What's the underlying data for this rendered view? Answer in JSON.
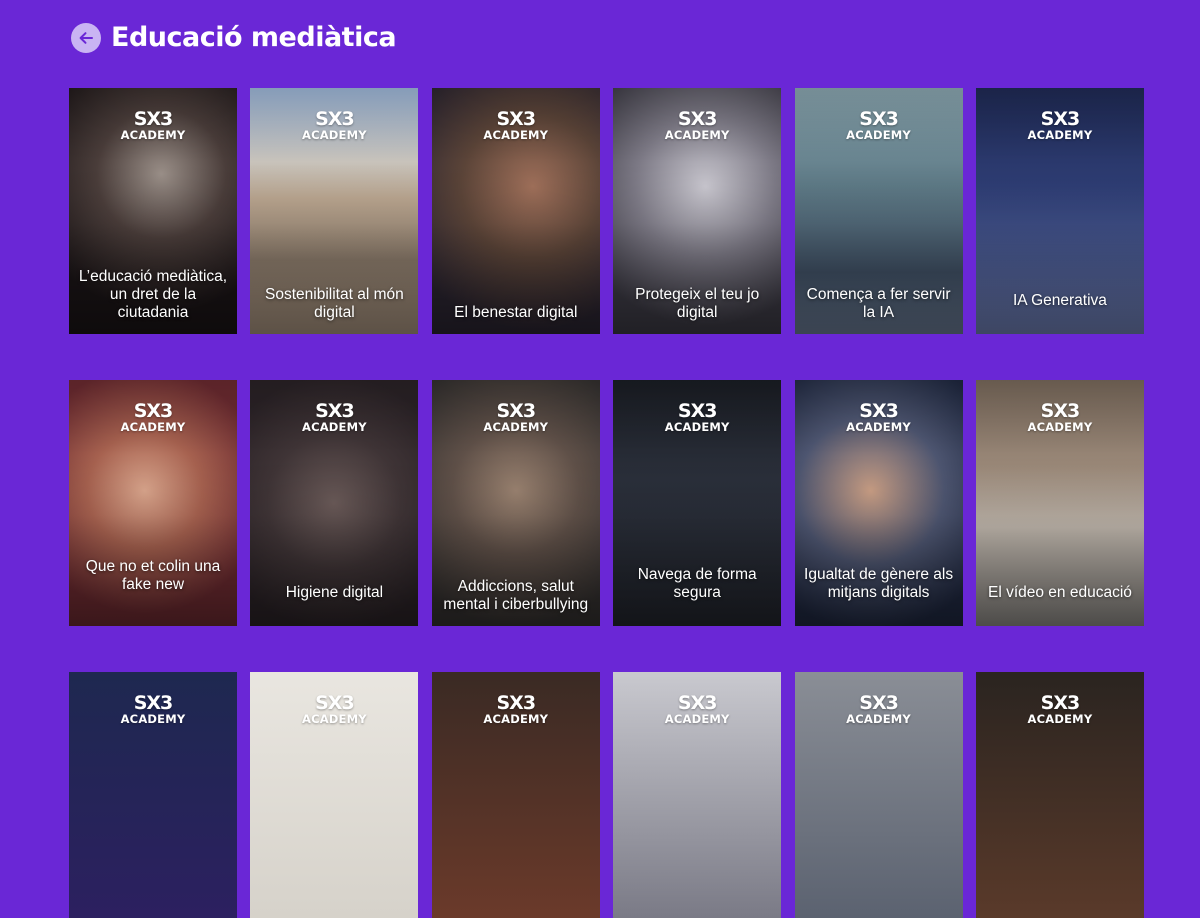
{
  "header": {
    "title": "Educació mediàtica",
    "back_icon": "arrow-left-icon"
  },
  "brand": {
    "logo_top": "SX3",
    "logo_bottom": "ACADEMY"
  },
  "colors": {
    "background": "#6a27d6",
    "back_button": "#c9b4f3"
  },
  "cards": [
    {
      "title": "L’educació mediàtica, un dret de la ciutadania"
    },
    {
      "title": "Sostenibilitat al món digital"
    },
    {
      "title": "El benestar digital"
    },
    {
      "title": "Protegeix el teu jo digital"
    },
    {
      "title": "Comença a fer servir la IA"
    },
    {
      "title": "IA Generativa"
    },
    {
      "title": "Que no et colin una fake new"
    },
    {
      "title": "Higiene digital"
    },
    {
      "title": "Addiccions, salut mental i ciberbullying"
    },
    {
      "title": "Navega de forma segura"
    },
    {
      "title": "Igualtat de gènere als mitjans digitals"
    },
    {
      "title": "El vídeo en educació"
    }
  ]
}
